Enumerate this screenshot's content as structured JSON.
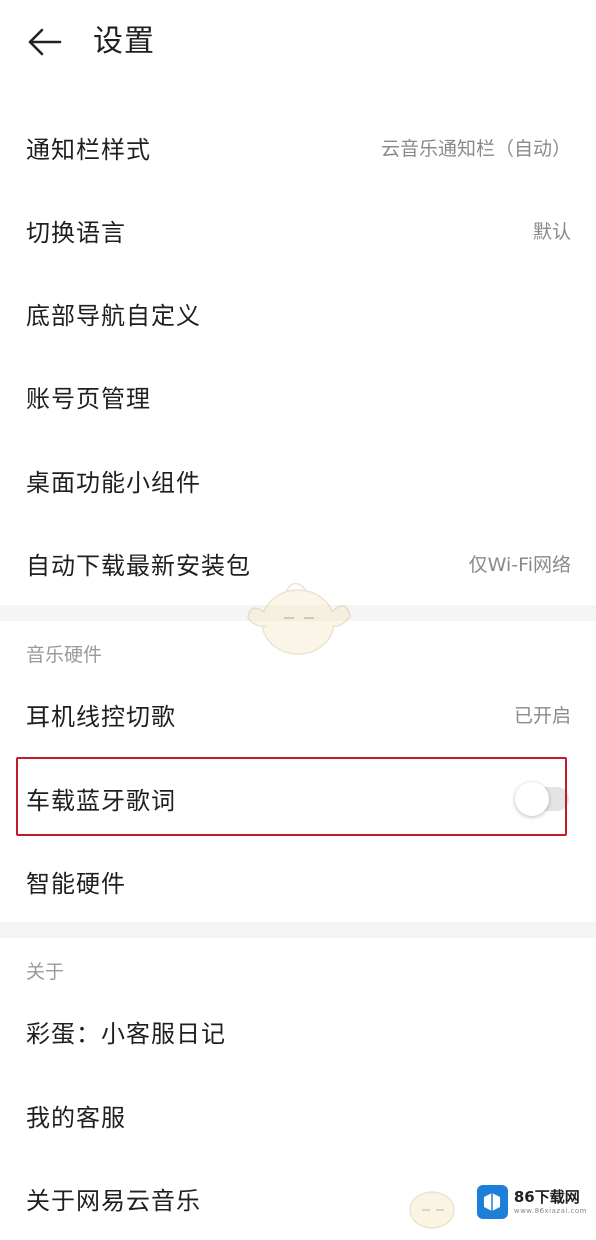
{
  "header": {
    "title": "设置"
  },
  "general": {
    "items": [
      {
        "label": "通知栏样式",
        "value": "云音乐通知栏（自动）"
      },
      {
        "label": "切换语言",
        "value": "默认"
      },
      {
        "label": "底部导航自定义",
        "value": ""
      },
      {
        "label": "账号页管理",
        "value": ""
      },
      {
        "label": "桌面功能小组件",
        "value": ""
      },
      {
        "label": "自动下载最新安装包",
        "value": "仅Wi-Fi网络"
      }
    ]
  },
  "music_hardware": {
    "title": "音乐硬件",
    "items": [
      {
        "label": "耳机线控切歌",
        "value": "已开启"
      },
      {
        "label": "车载蓝牙歌词",
        "toggle_on": false
      },
      {
        "label": "智能硬件",
        "value": ""
      }
    ]
  },
  "about": {
    "title": "关于",
    "items": [
      {
        "label": "彩蛋：小客服日记"
      },
      {
        "label": "我的客服"
      },
      {
        "label": "关于网易云音乐"
      }
    ]
  },
  "watermark": {
    "title": "86下载网",
    "subtitle": "www.86xiazai.com"
  },
  "colors": {
    "highlight_border": "#c21c2c",
    "section_bg": "#f5f5f5"
  }
}
